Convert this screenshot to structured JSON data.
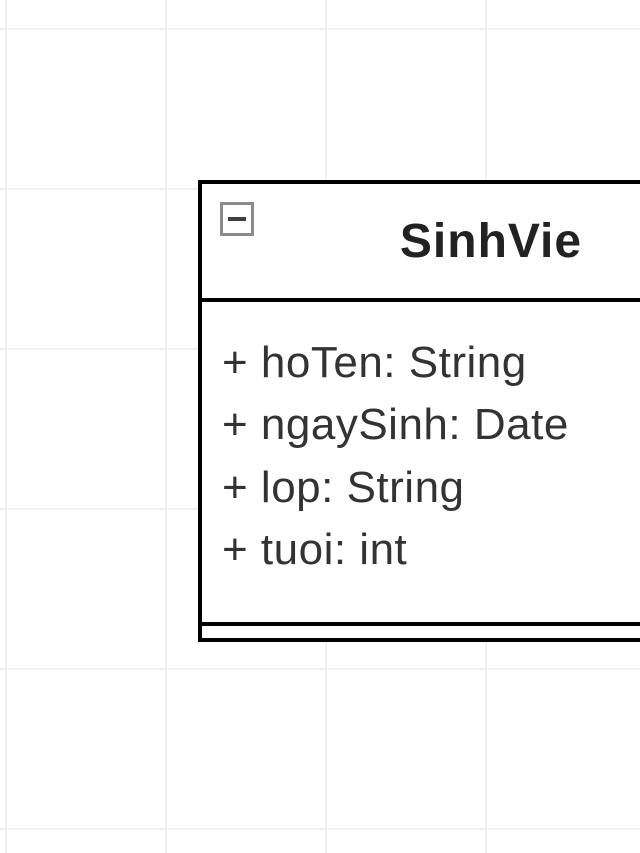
{
  "class": {
    "name": "SinhVie",
    "attributes": [
      "+ hoTen: String",
      "+ ngaySinh: Date",
      "+ lop: String",
      "+ tuoi: int"
    ]
  }
}
